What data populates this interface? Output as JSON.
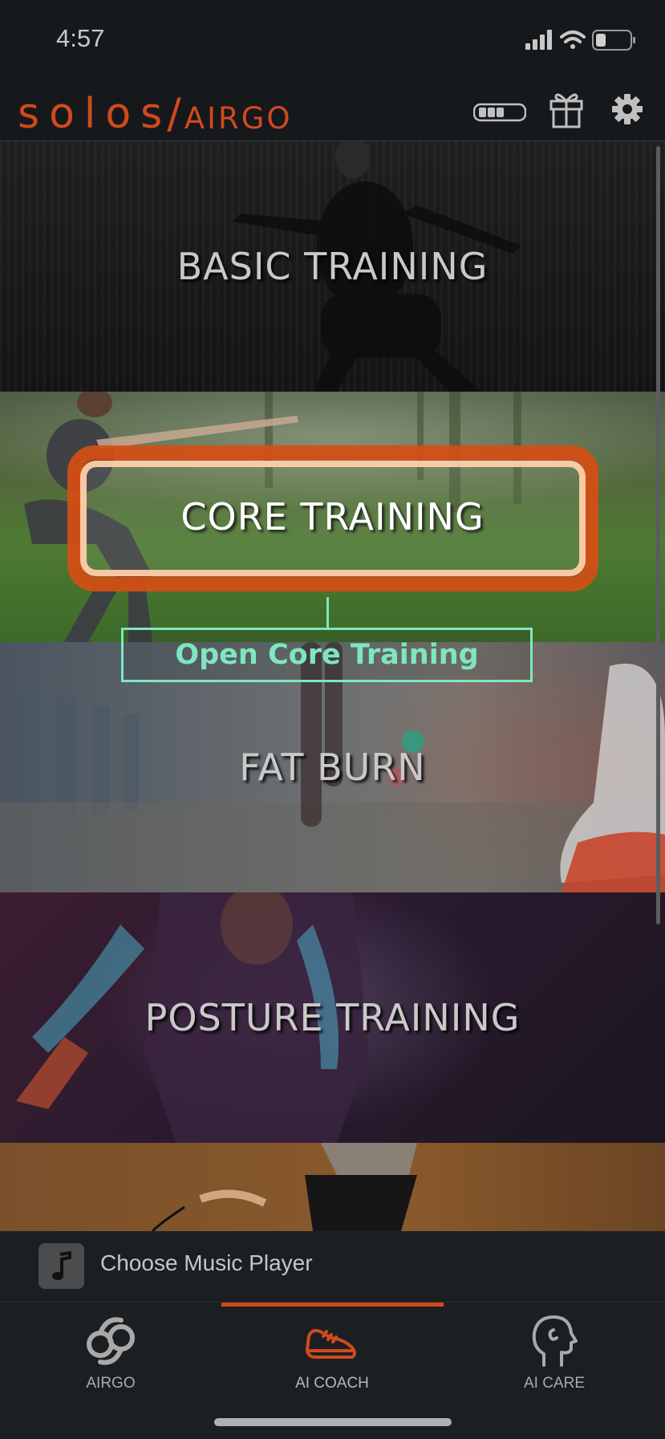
{
  "status_bar": {
    "time": "4:57"
  },
  "header": {
    "logo_main": "solos",
    "logo_slash": "/",
    "logo_sub": "AIRGO"
  },
  "tiles": [
    {
      "label": "BASIC TRAINING"
    },
    {
      "label": "CORE TRAINING"
    },
    {
      "label": "FAT BURN"
    },
    {
      "label": "POSTURE TRAINING"
    }
  ],
  "callout": {
    "label": "Open Core Training"
  },
  "music": {
    "label": "Choose Music Player",
    "icon": "music-note-icon"
  },
  "tabs": [
    {
      "label": "AIRGO",
      "icon": "airgo-icon",
      "active": false
    },
    {
      "label": "AI COACH",
      "icon": "running-shoe-icon",
      "active": true
    },
    {
      "label": "AI CARE",
      "icon": "head-profile-icon",
      "active": false
    }
  ],
  "colors": {
    "brand": "#d04a1e",
    "highlight": "#d64e14",
    "callout": "#7fe6c0",
    "background": "#16191c"
  }
}
